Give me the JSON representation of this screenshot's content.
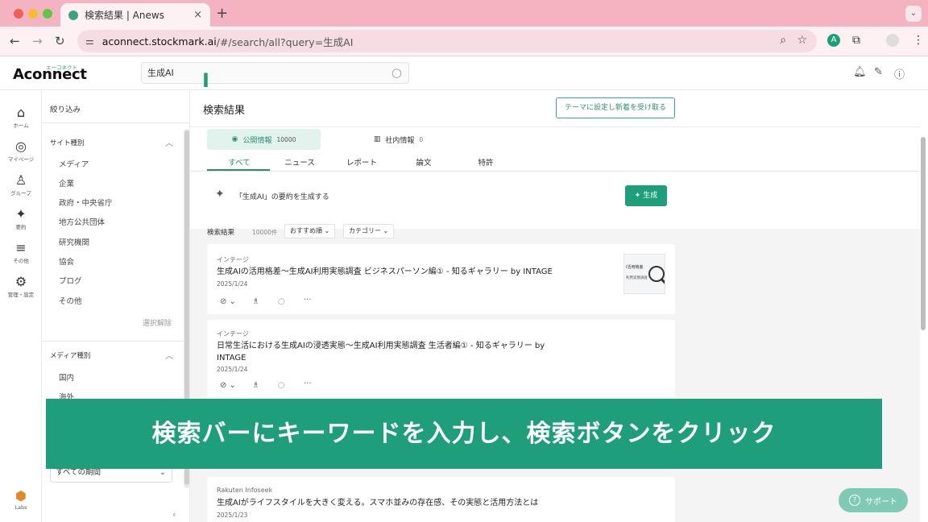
{
  "browser": {
    "tab_title": "検索結果 | Anews",
    "tab_close": "×",
    "new_tab": "+",
    "url_domain": "aconnect.stockmark.ai",
    "url_path": "/#/search/all?query=生成AI",
    "traffic_colors": [
      "#ee5f58",
      "#f5bd2f",
      "#5fc73f"
    ]
  },
  "header": {
    "logo": "Aconnect",
    "logo_sub": "エーコネクト",
    "search_value": "生成AI"
  },
  "rail": [
    {
      "icon": "home-icon",
      "glyph": "⌂",
      "label": "ホーム"
    },
    {
      "icon": "user-icon",
      "glyph": "◎",
      "label": "マイページ"
    },
    {
      "icon": "group-icon",
      "glyph": "♙",
      "label": "グループ"
    },
    {
      "icon": "sparkle-icon",
      "glyph": "✦",
      "label": "要約"
    },
    {
      "icon": "menu-icon",
      "glyph": "≡",
      "label": "その他"
    },
    {
      "icon": "gear-icon",
      "glyph": "⚙",
      "label": "管理・設定"
    }
  ],
  "labs_label": "Labs",
  "filter": {
    "title": "絞り込み",
    "site_section": "サイト種別",
    "site_items": [
      "メディア",
      "企業",
      "政府・中央省庁",
      "地方公共団体",
      "研究機関",
      "協会",
      "ブログ",
      "その他"
    ],
    "clear": "選択解除",
    "media_section": "メディア種別",
    "media_items": [
      "国内",
      "海外"
    ],
    "period": "すべての期間"
  },
  "main": {
    "title": "検索結果",
    "theme_button": "テーマに設定し新着を受け取る",
    "source_tabs": [
      {
        "label": "公開情報",
        "count": "10000"
      },
      {
        "label": "社内情報",
        "count": "0"
      }
    ],
    "sub_tabs": [
      "すべて",
      "ニュース",
      "レポート",
      "論文",
      "特許"
    ],
    "summary_text": "「生成AI」の要約を生成する",
    "generate_button": "生成",
    "results_label": "検索結果",
    "results_count": "10000件",
    "sort": "おすすめ順",
    "category": "カテゴリー"
  },
  "results": [
    {
      "source": "インテージ",
      "title": "生成AIの活用格差〜生成AI利用実態調査 ビジネスパーソン編① - 知るギャラリー by INTAGE",
      "date": "2025/1/24",
      "thumb_line1": "I活用格差",
      "thumb_line2": "利用実態調査"
    },
    {
      "source": "インテージ",
      "title": "日常生活における生成AIの浸透実態〜生成AI利用実態調査 生活者編① - 知るギャラリー by INTAGE",
      "date": "2025/1/24"
    },
    {
      "source": "Rakuten Infoseek",
      "title": "生成AIがライフスタイルを大きく変える。スマホ並みの存在感、その実態と活用方法とは",
      "date": "2025/1/23"
    }
  ],
  "banner_text": "検索バーにキーワードを入力し、検索ボタンをクリック",
  "support_label": "サポート",
  "accent": "#1f9e7c"
}
